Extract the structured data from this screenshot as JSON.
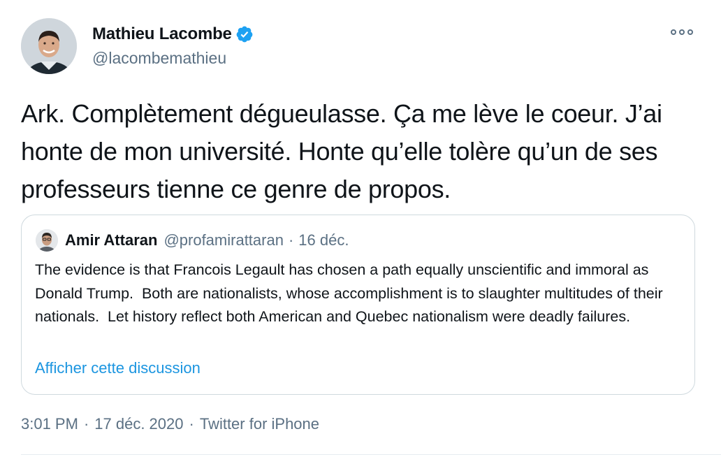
{
  "author": {
    "display_name": "Mathieu Lacombe",
    "handle": "@lacombemathieu",
    "verified_icon": "verified-badge-icon",
    "avatar_icon": "profile-photo"
  },
  "tweet": {
    "text": "Ark. Complètement dégueulasse. Ça me lève le coeur. J’ai honte de mon université. Honte qu’elle tolère qu’un de ses professeurs tienne ce genre de propos.",
    "more_icon": "more-options-icon"
  },
  "quoted_tweet": {
    "display_name": "Amir Attaran",
    "handle": "@profamirattaran",
    "separator": "·",
    "date": "16 déc.",
    "text": "The evidence is that Francois Legault has chosen a path equally unscientific and immoral as Donald Trump.  Both are nationalists, whose accomplishment is to slaughter multitudes of their nationals.  Let history reflect both American and Quebec nationalism were deadly failures.",
    "show_thread_label": "Afficher cette discussion"
  },
  "meta": {
    "time": "3:01 PM",
    "separator": "·",
    "date": "17 déc. 2020",
    "source": "Twitter for iPhone"
  },
  "colors": {
    "text_primary": "#0f1419",
    "text_secondary": "#5b7083",
    "link": "#1b95e0",
    "verified": "#1da1f2",
    "border": "#cfd9de"
  }
}
